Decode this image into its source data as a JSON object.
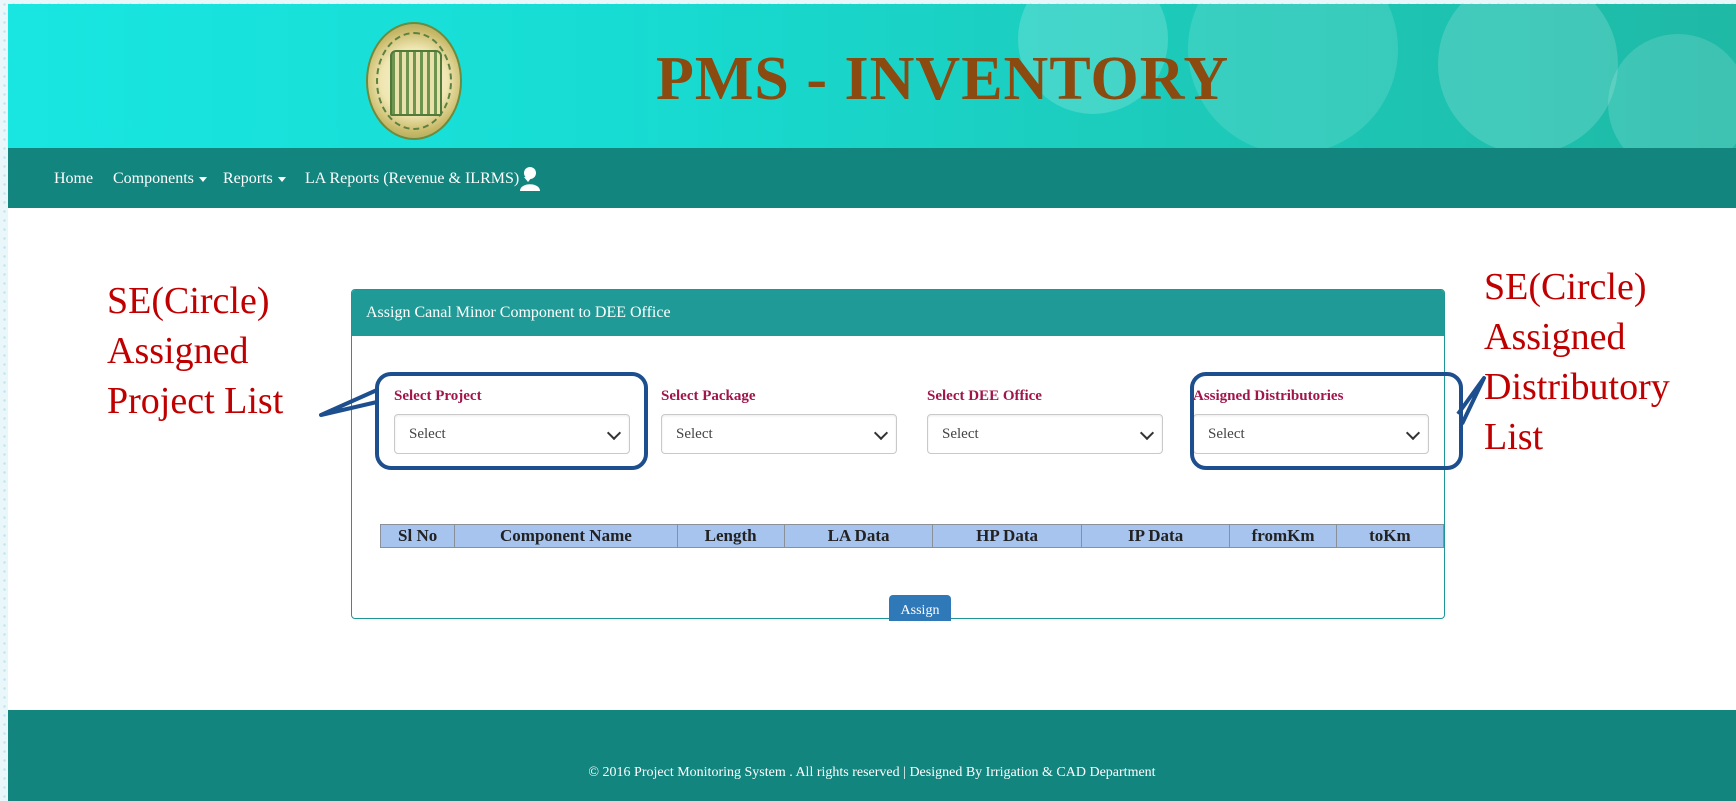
{
  "header": {
    "title": "PMS - INVENTORY",
    "logo_icon": "telangana-emblem"
  },
  "nav": {
    "items": [
      {
        "label": "Home"
      },
      {
        "label": "Components"
      },
      {
        "label": "Reports"
      },
      {
        "label": "LA Reports (Revenue & ILRMS)"
      }
    ],
    "user_icon": "user-icon"
  },
  "panel": {
    "title": "Assign Canal Minor Component to DEE Office",
    "fields": [
      {
        "label": "Select Project",
        "value": "Select"
      },
      {
        "label": "Select Package",
        "value": "Select"
      },
      {
        "label": "Select DEE Office",
        "value": "Select"
      },
      {
        "label": "Assigned Distributories",
        "value": "Select"
      }
    ],
    "table_headers": [
      "Sl No",
      "Component Name",
      "Length",
      "LA Data",
      "HP Data",
      "IP Data",
      "fromKm",
      "toKm"
    ],
    "assign_label": "Assign"
  },
  "footer": {
    "text": "© 2016 Project Monitoring System . All rights reserved | Designed By Irrigation & CAD Department"
  },
  "annotations": {
    "left": [
      "SE(Circle)",
      "Assigned",
      "Project List"
    ],
    "right": [
      "SE(Circle)",
      "Assigned",
      "Distributory",
      "List"
    ]
  },
  "colors": {
    "header_gradient_start": "#19e6e1",
    "nav_bg": "#12857f",
    "panel_head_bg": "#1f9a96",
    "label_color": "#a0154a",
    "title_color": "#8a4a10",
    "annotation_color": "#c00000",
    "callout_border": "#1d4f8e",
    "table_header_bg": "#a7c4ee"
  }
}
